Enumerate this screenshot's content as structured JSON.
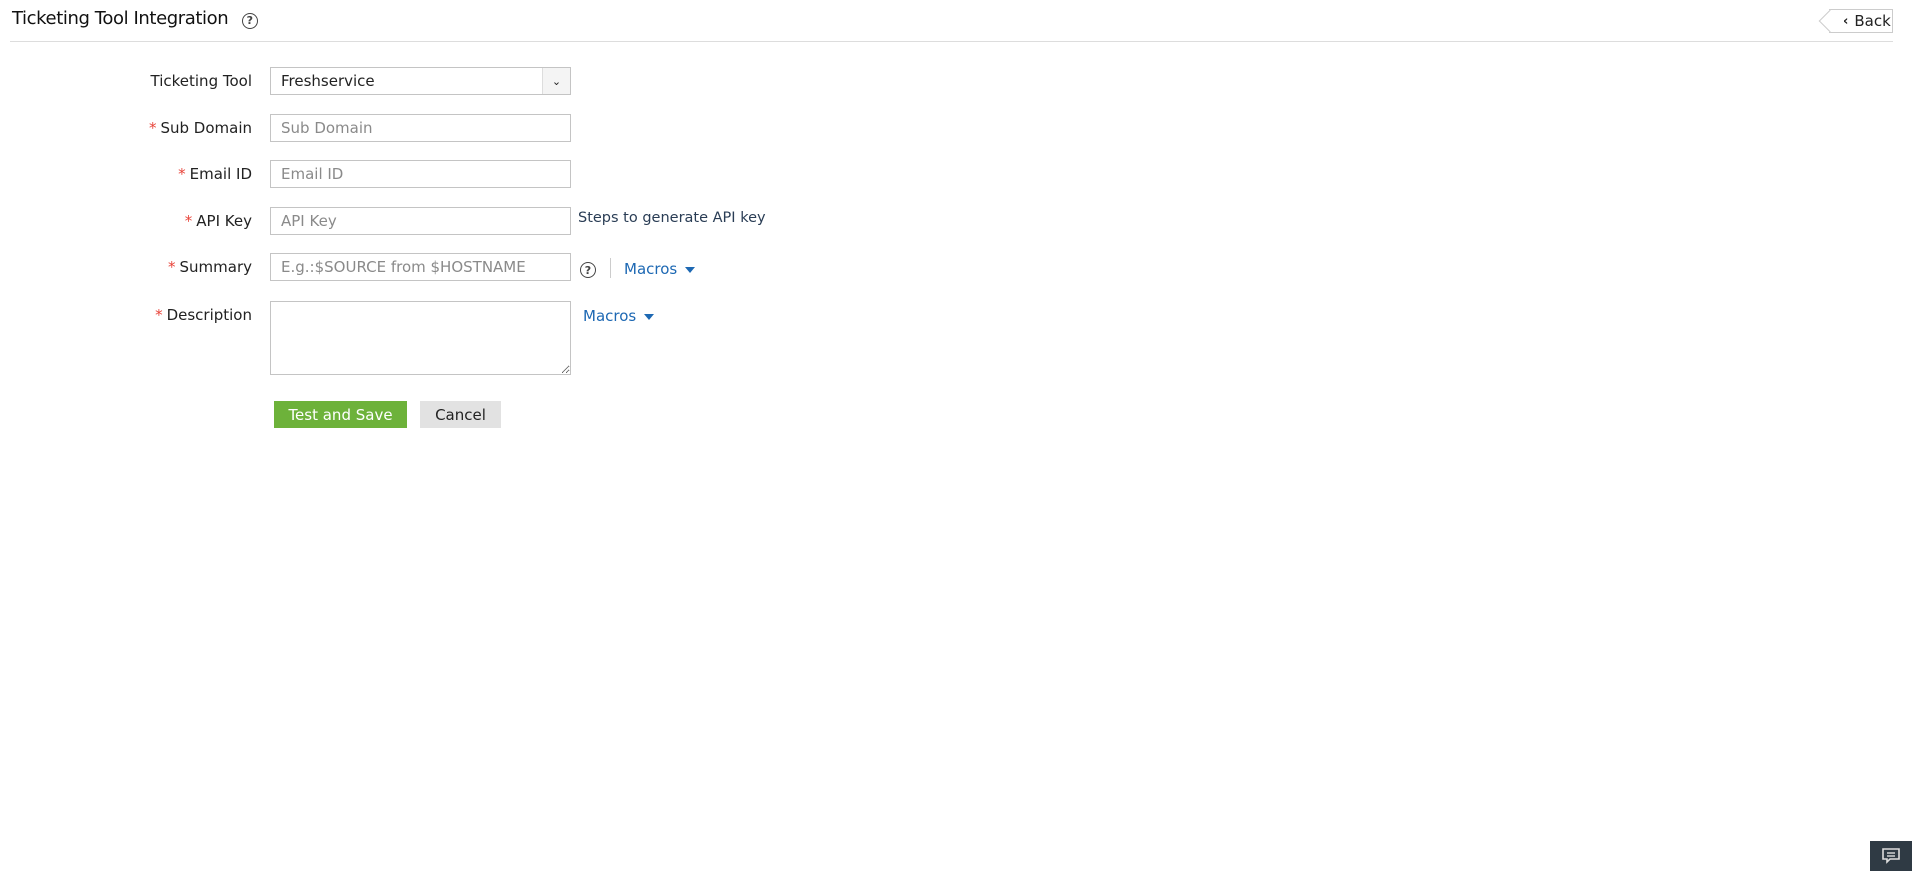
{
  "header": {
    "title": "Ticketing Tool Integration",
    "help_icon": "question-circle-icon",
    "back_label": "Back"
  },
  "form": {
    "ticketing_tool": {
      "label": "Ticketing Tool",
      "value": "Freshservice"
    },
    "sub_domain": {
      "required": "*",
      "label": "Sub Domain",
      "placeholder": "Sub Domain",
      "value": ""
    },
    "email_id": {
      "required": "*",
      "label": "Email ID",
      "placeholder": "Email ID",
      "value": ""
    },
    "api_key": {
      "required": "*",
      "label": "API Key",
      "placeholder": "API Key",
      "value": "",
      "help_link": "Steps to generate API key"
    },
    "summary": {
      "required": "*",
      "label": "Summary",
      "placeholder": "E.g.:$SOURCE from $HOSTNAME",
      "value": "",
      "macros_label": "Macros"
    },
    "description": {
      "required": "*",
      "label": "Description",
      "value": "",
      "macros_label": "Macros"
    },
    "buttons": {
      "save": "Test and Save",
      "cancel": "Cancel"
    }
  },
  "colors": {
    "primary_button": "#6db23a",
    "link": "#1d68b3",
    "required": "#e8443a"
  }
}
